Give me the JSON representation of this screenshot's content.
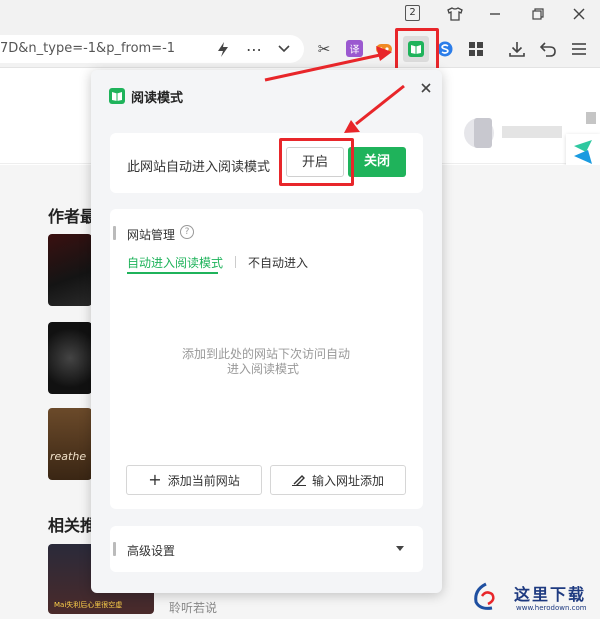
{
  "window": {
    "tab_count": "2",
    "url_text": "7D&n_type=-1&p_from=-1"
  },
  "toolbar": {
    "translate_label": "译"
  },
  "page": {
    "section_author": "作者最",
    "section_related": "相关推",
    "bottom_text": "聆听若说",
    "thumb_text": "Mai失利后心里很空虚",
    "thumb2_text": "reathe"
  },
  "popup": {
    "title": "阅读模式",
    "auto_enter_label": "此网站自动进入阅读模式",
    "open_button": "开启",
    "close_button": "关闭",
    "site_manage_title": "网站管理",
    "tab_auto": "自动进入阅读模式",
    "tab_no_auto": "不自动进入",
    "empty_hint_line1": "添加到此处的网站下次访问自动",
    "empty_hint_line2": "进入阅读模式",
    "add_current_site": "添加当前网站",
    "input_url_add": "输入网址添加",
    "advanced_settings": "高级设置"
  },
  "watermark": {
    "brand": "这里下载",
    "url": "www.herodown.com"
  },
  "colors": {
    "accent_green": "#1fb35b",
    "annotation_red": "#e8262a"
  }
}
